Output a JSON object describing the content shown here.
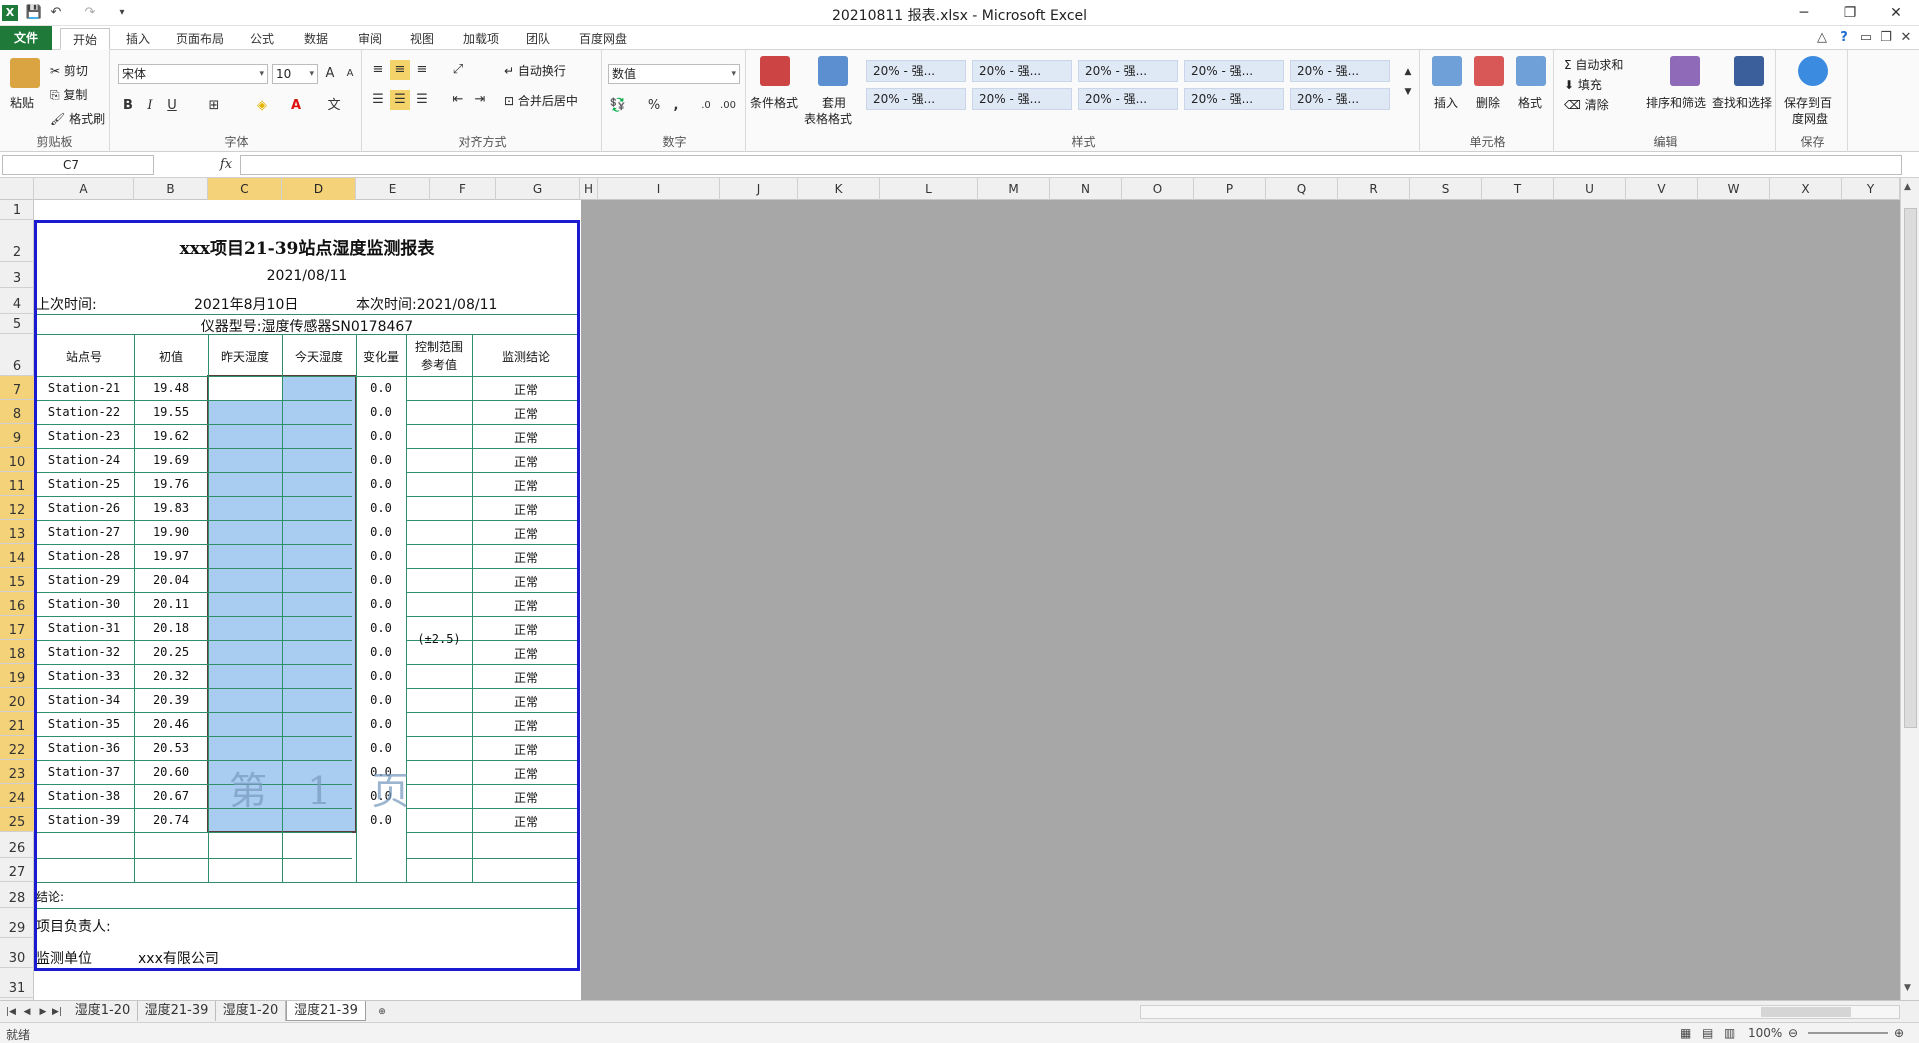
{
  "window": {
    "title": "20210811 报表.xlsx - Microsoft Excel",
    "controls": {
      "minimize": "─",
      "restore": "❐",
      "close": "✕"
    }
  },
  "ribbon_tabs": [
    "文件",
    "开始",
    "插入",
    "页面布局",
    "公式",
    "数据",
    "审阅",
    "视图",
    "加载项",
    "团队",
    "百度网盘"
  ],
  "ribbon": {
    "clipboard": {
      "paste": "粘贴",
      "cut": "剪切",
      "copy": "复制",
      "format_painter": "格式刷",
      "label": "剪贴板"
    },
    "font": {
      "name": "宋体",
      "size": "10",
      "label": "字体",
      "bold": "B",
      "italic": "I",
      "underline": "U"
    },
    "alignment": {
      "wrap": "自动换行",
      "merge": "合并后居中",
      "label": "对齐方式"
    },
    "number": {
      "format": "数值",
      "label": "数字",
      "percent": "%",
      "comma": ","
    },
    "styles": {
      "conditional": "条件格式",
      "table_l1": "套用",
      "table_l2": "表格格式",
      "label": "样式",
      "cells": [
        "20% - 强...",
        "20% - 强...",
        "20% - 强...",
        "20% - 强...",
        "20% - 强...",
        "20% - 强...",
        "20% - 强...",
        "20% - 强...",
        "20% - 强...",
        "20% - 强..."
      ]
    },
    "cells": {
      "insert": "插入",
      "delete": "删除",
      "format": "格式",
      "label": "单元格"
    },
    "editing": {
      "autosum": "自动求和",
      "fill": "填充",
      "clear": "清除",
      "sort": "排序和筛选",
      "find": "查找和选择",
      "label": "编辑"
    },
    "save": {
      "l1": "保存到百",
      "l2": "度网盘",
      "label": "保存"
    }
  },
  "formula_bar": {
    "name_box": "C7",
    "fx": "fx",
    "value": ""
  },
  "columns": [
    "A",
    "B",
    "C",
    "D",
    "E",
    "F",
    "G",
    "H",
    "I",
    "J",
    "K",
    "L",
    "M",
    "N",
    "O",
    "P",
    "Q",
    "R",
    "S",
    "T",
    "U",
    "V",
    "W",
    "X",
    "Y"
  ],
  "rows": [
    "1",
    "2",
    "3",
    "4",
    "5",
    "6",
    "7",
    "8",
    "9",
    "10",
    "11",
    "12",
    "13",
    "14",
    "15",
    "16",
    "17",
    "18",
    "19",
    "20",
    "21",
    "22",
    "23",
    "24",
    "25",
    "26",
    "27",
    "28",
    "29",
    "30",
    "31"
  ],
  "report": {
    "title": "xxx项目21-39站点湿度监测报表",
    "date": "2021/08/11",
    "prev_time_label": "上次时间:",
    "prev_time_value": "2021年8月10日",
    "this_time": "本次时间:2021/08/11",
    "instrument": "仪器型号:湿度传感器SN0178467",
    "headers": [
      "站点号",
      "初值",
      "昨天湿度",
      "今天湿度",
      "变化量",
      "控制范围",
      "参考值",
      "监测结论"
    ],
    "control_range": "(±2.5)",
    "conclusion_label": "结论:",
    "responsible_label": "项目负责人:",
    "unit_label": "监测单位",
    "unit_value": "xxx有限公司",
    "watermark": "第 1 页",
    "stations": [
      {
        "id": "Station-21",
        "init": "19.48",
        "change": "0.0",
        "result": "正常"
      },
      {
        "id": "Station-22",
        "init": "19.55",
        "change": "0.0",
        "result": "正常"
      },
      {
        "id": "Station-23",
        "init": "19.62",
        "change": "0.0",
        "result": "正常"
      },
      {
        "id": "Station-24",
        "init": "19.69",
        "change": "0.0",
        "result": "正常"
      },
      {
        "id": "Station-25",
        "init": "19.76",
        "change": "0.0",
        "result": "正常"
      },
      {
        "id": "Station-26",
        "init": "19.83",
        "change": "0.0",
        "result": "正常"
      },
      {
        "id": "Station-27",
        "init": "19.90",
        "change": "0.0",
        "result": "正常"
      },
      {
        "id": "Station-28",
        "init": "19.97",
        "change": "0.0",
        "result": "正常"
      },
      {
        "id": "Station-29",
        "init": "20.04",
        "change": "0.0",
        "result": "正常"
      },
      {
        "id": "Station-30",
        "init": "20.11",
        "change": "0.0",
        "result": "正常"
      },
      {
        "id": "Station-31",
        "init": "20.18",
        "change": "0.0",
        "result": "正常"
      },
      {
        "id": "Station-32",
        "init": "20.25",
        "change": "0.0",
        "result": "正常"
      },
      {
        "id": "Station-33",
        "init": "20.32",
        "change": "0.0",
        "result": "正常"
      },
      {
        "id": "Station-34",
        "init": "20.39",
        "change": "0.0",
        "result": "正常"
      },
      {
        "id": "Station-35",
        "init": "20.46",
        "change": "0.0",
        "result": "正常"
      },
      {
        "id": "Station-36",
        "init": "20.53",
        "change": "0.0",
        "result": "正常"
      },
      {
        "id": "Station-37",
        "init": "20.60",
        "change": "0.0",
        "result": "正常"
      },
      {
        "id": "Station-38",
        "init": "20.67",
        "change": "0.0",
        "result": "正常"
      },
      {
        "id": "Station-39",
        "init": "20.74",
        "change": "0.0",
        "result": "正常"
      }
    ]
  },
  "sheet_tabs": [
    "湿度1-20",
    "湿度21-39",
    "湿度1-20",
    "湿度21-39"
  ],
  "active_sheet": "湿度21-39",
  "status": {
    "ready": "就绪",
    "zoom": "100%"
  },
  "colors": {
    "file_tab": "#1f7a3a",
    "selection": "#a8cdf0",
    "print_frame": "#1a1ad0",
    "table_lines": "#2f8f6a",
    "header_highlight": "#f3d27a"
  }
}
